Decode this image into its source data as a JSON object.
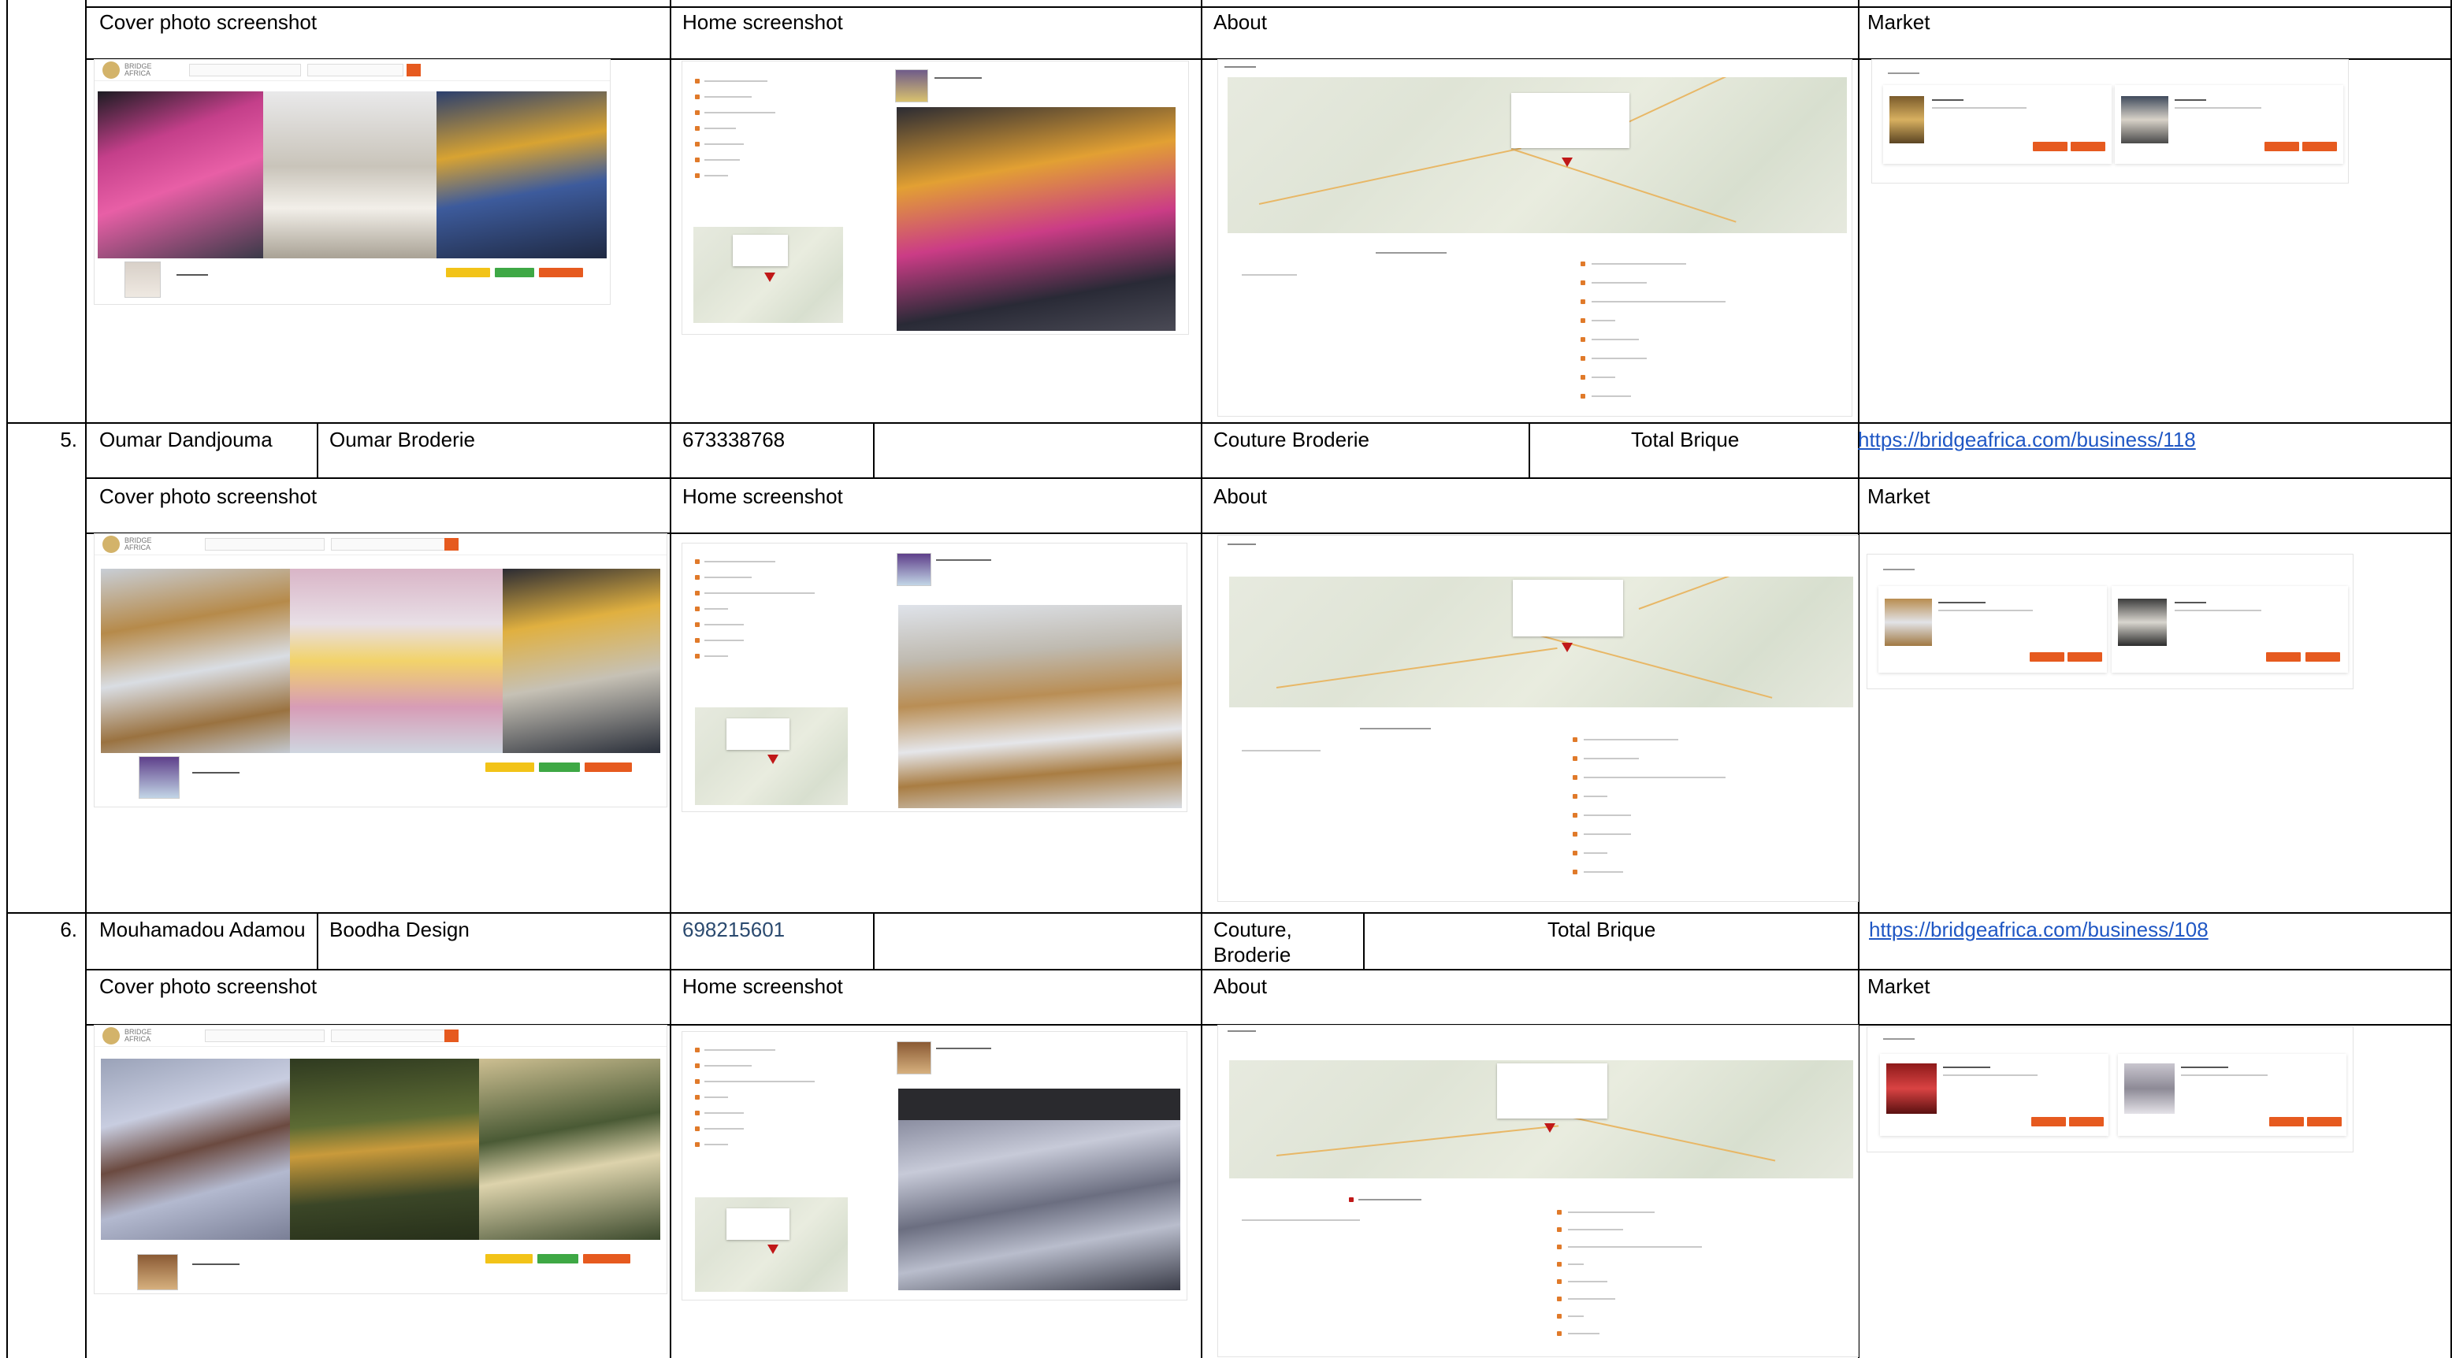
{
  "headers": {
    "cover": "Cover photo screenshot",
    "home": "Home screenshot",
    "about": "About",
    "market": "Market"
  },
  "rows": [
    {
      "num": "5.",
      "owner": "Oumar Dandjouma",
      "business": "Oumar Broderie",
      "phone": "673338768",
      "category": "Couture Broderie",
      "package": "Total Brique",
      "link": "https://bridgeafrica.com/business/118"
    },
    {
      "num": "6.",
      "owner": "Mouhamadou Adamou",
      "business": "Boodha Design",
      "phone": "698215601",
      "category": "Couture, Broderie",
      "package": "Total Brique",
      "link": "https://bridgeafrica.com/business/108"
    }
  ],
  "colors": {
    "link": "#1f57c4",
    "brand_orange": "#e65a1f",
    "btn_yellow": "#f2c318",
    "btn_green": "#3ea845",
    "map_pin": "#c01818"
  },
  "thumbnails": {
    "row4": {
      "cover": "Axel fashion cover screenshot",
      "home": "Axel fashion home screenshot",
      "about": "Axel fashion about map screenshot",
      "market": "Axel fashion market screenshot"
    },
    "row5": {
      "cover": "Oumar broderie cover screenshot",
      "home": "Oumar broderie home screenshot",
      "about": "Oumar broderie about map screenshot",
      "market": "Oumar broderie market screenshot"
    },
    "row6": {
      "cover": "Boodha design cover screenshot",
      "home": "Boodha design home screenshot",
      "about": "Boodha design about map screenshot",
      "market": "Boodha design market screenshot"
    }
  }
}
